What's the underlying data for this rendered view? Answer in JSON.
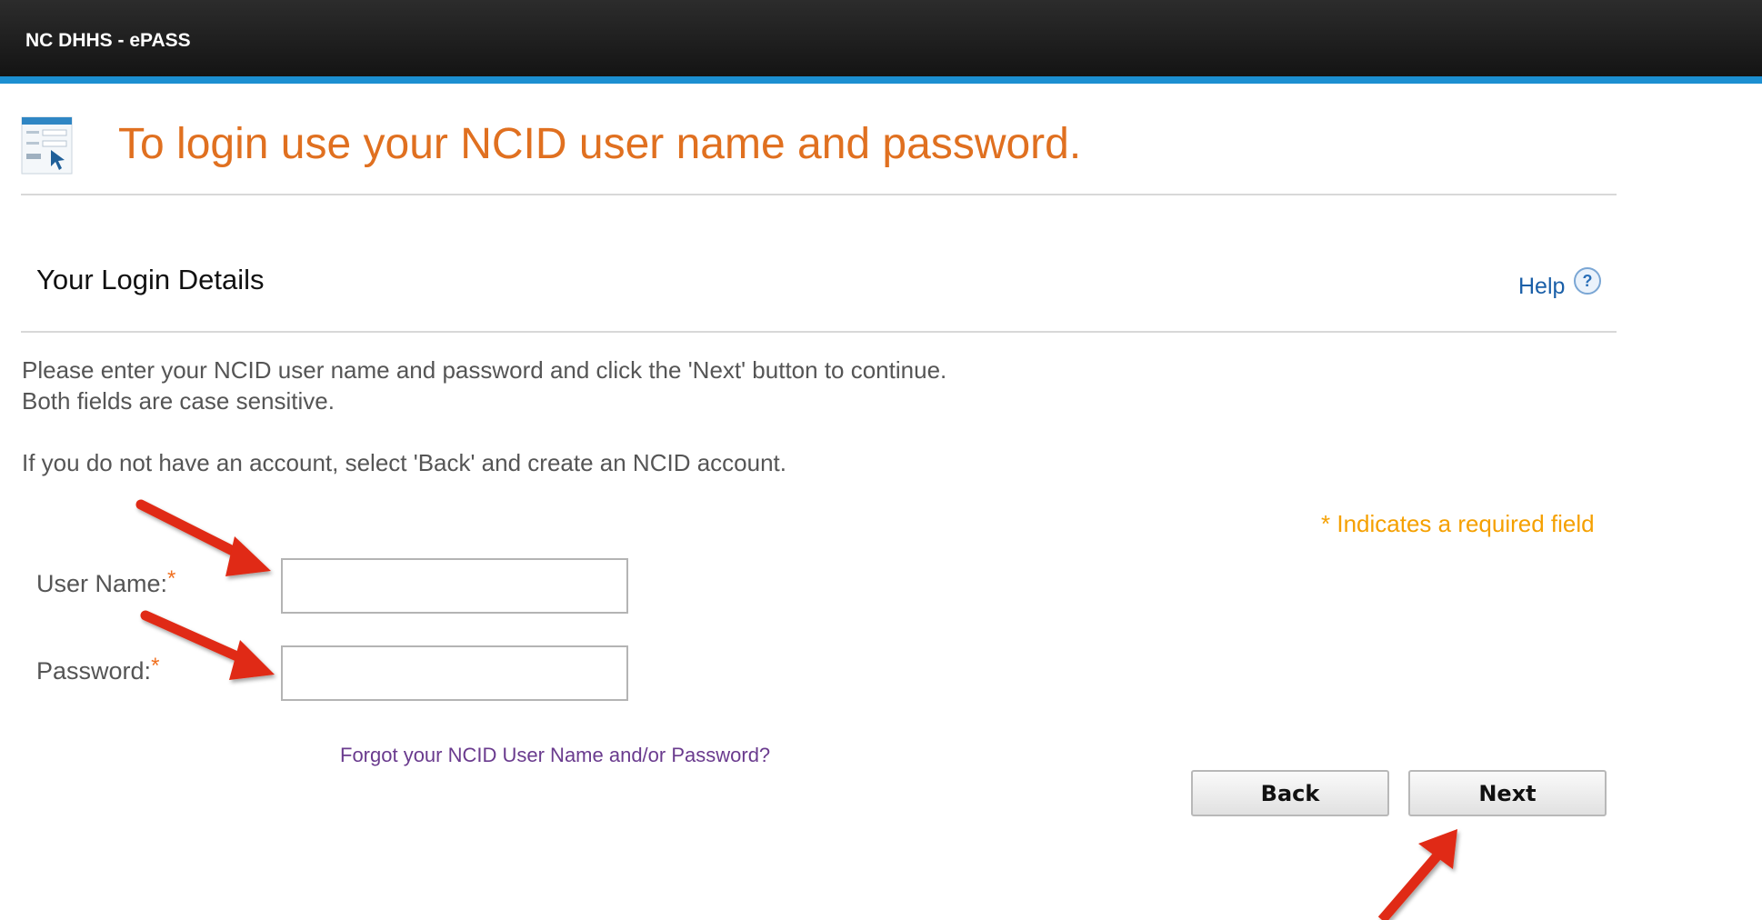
{
  "header": {
    "brand": "NC DHHS - ePASS"
  },
  "page": {
    "title": "To login use your NCID user name and password."
  },
  "section": {
    "title": "Your Login Details",
    "help_label": "Help"
  },
  "instructions": {
    "line1": "Please enter your NCID user name and password and click the 'Next' button to continue.",
    "line2": "Both fields are case sensitive.",
    "line3": "If you do not have an account, select 'Back' and create an NCID account."
  },
  "form": {
    "required_note": "* Indicates a required field",
    "username_label": "User Name:",
    "username_value": "",
    "password_label": "Password:",
    "password_value": "",
    "required_star": "*",
    "forgot_link": "Forgot your NCID User Name and/or Password?"
  },
  "buttons": {
    "back_label": "Back",
    "next_label": "Next"
  },
  "annotations": {
    "arrow_color": "#e02a12",
    "arrow_count": 3
  },
  "colors": {
    "title_orange": "#e07020",
    "accent_blue": "#1c8fd1",
    "required_orange": "#f5a000",
    "link_blue": "#1a5fa8",
    "link_purple": "#6a3b8e"
  }
}
